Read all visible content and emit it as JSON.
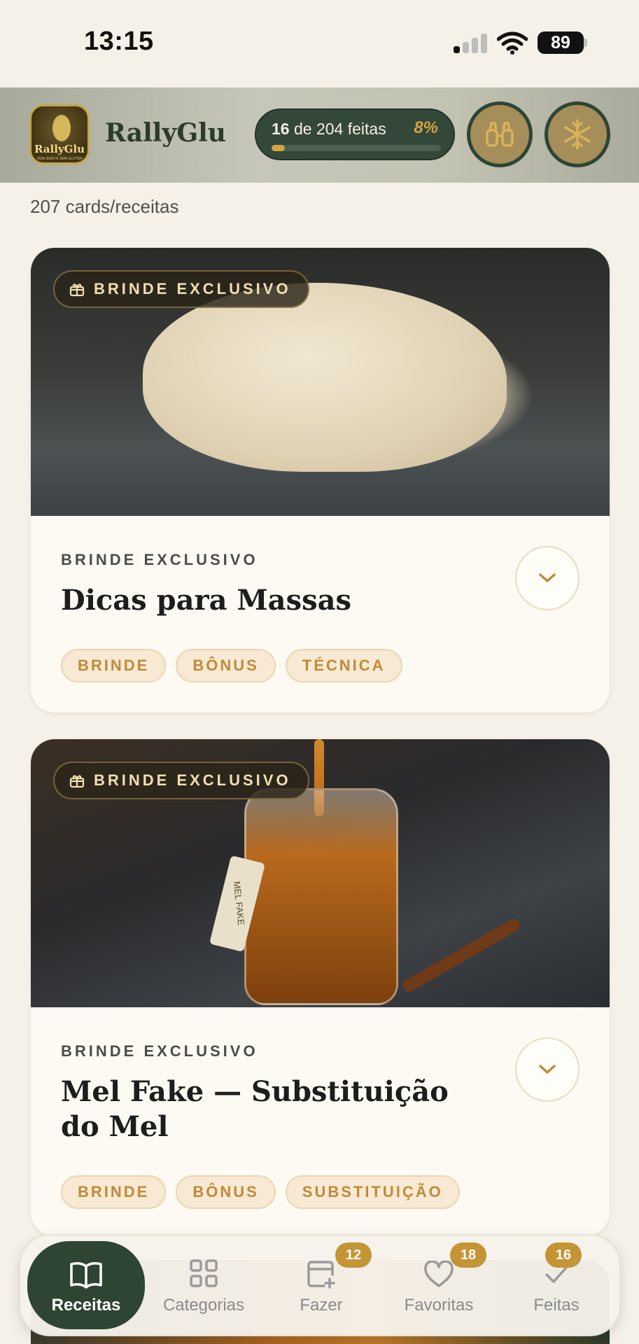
{
  "status_bar": {
    "time": "13:15",
    "battery": "89"
  },
  "header": {
    "brand_name": "RallyGlu",
    "logo_text": "RallyGlu",
    "logo_subtext": "VIDA ZERO E SEM GLÚTEN",
    "progress": {
      "done": "16",
      "middle": " de 204 feitas",
      "percent": "8%",
      "fraction": 0.08
    }
  },
  "count_text": "207 cards/receitas",
  "cards": [
    {
      "badge": "BRINDE EXCLUSIVO",
      "eyebrow": "BRINDE EXCLUSIVO",
      "title": "Dicas para Massas",
      "tags": [
        "BRINDE",
        "BÔNUS",
        "TÉCNICA"
      ]
    },
    {
      "badge": "BRINDE EXCLUSIVO",
      "eyebrow": "BRINDE EXCLUSIVO",
      "title": "Mel Fake — Substituição do Mel",
      "tags": [
        "BRINDE",
        "BÔNUS",
        "SUBSTITUIÇÃO"
      ],
      "image_tag_text": "MEL FAKE"
    }
  ],
  "tabs": [
    {
      "label": "Receitas",
      "icon": "book-icon",
      "active": true
    },
    {
      "label": "Categorias",
      "icon": "grid-icon"
    },
    {
      "label": "Fazer",
      "icon": "calendar-plus-icon",
      "count": "12"
    },
    {
      "label": "Favoritas",
      "icon": "heart-icon",
      "count": "18"
    },
    {
      "label": "Feitas",
      "icon": "check-icon",
      "count": "16"
    }
  ],
  "colors": {
    "accent_green": "#2f4534",
    "accent_gold": "#c49435",
    "background": "#f5f1e8"
  }
}
